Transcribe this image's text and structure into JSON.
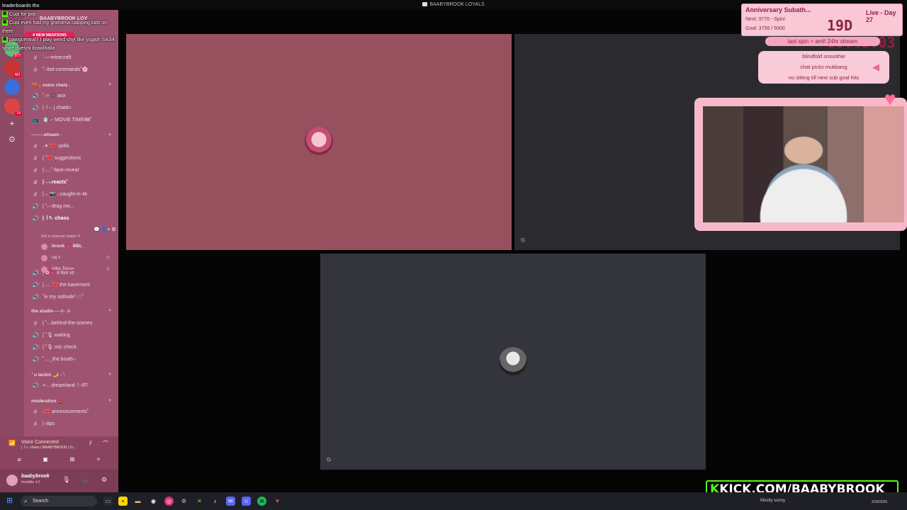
{
  "window": {
    "title": "BAABYBROOK LOYALS"
  },
  "chat_overlay": {
    "lines": [
      "leaderboards tho",
      "Cupi for pvp",
      "Cupi even had my grandma calpping kids on",
      "there",
      "pawgcentral7 I play weird shyt like yugioh SAS4",
      "smite duelyst brawlhalla"
    ]
  },
  "mentions": "4 NEW MENTIONS",
  "sidebar": {
    "server_name": "BAABYBROOK LOY",
    "rail_badges": [
      "973",
      "461",
      "14"
    ],
    "channels": [
      {
        "sym": "#",
        "label": "˙-˖--minecraft"
      },
      {
        "sym": "#",
        "label": "˚˖-bot-commands˚🌸"
      },
      {
        "cat": "˚🍓˖. voice chats ˖"
      },
      {
        "sym": "🔊",
        "label": "˚˖⊹🎧 aux"
      },
      {
        "sym": "🔊",
        "label": "| ꒰-˖ j chattin"
      },
      {
        "sym": "📺",
        "label": "🍵 ˖- MOVIE TIME🎟˚"
      },
      {
        "cat": "˖---──stream ˖"
      },
      {
        "sym": "#",
        "label": "˖✦ 🎀 -polls"
      },
      {
        "sym": "#",
        "label": "| ˚🎀 suggestions"
      },
      {
        "sym": "#",
        "label": "| ˖...˚-face-reveal"
      },
      {
        "sym": "#",
        "label": "| ˖˖-.reacts˚",
        "selected": true
      },
      {
        "sym": "#",
        "label": "| ˖˖ 📷 ₊caught-in-4k"
      },
      {
        "sym": "🔊",
        "label": "| ˚˖˖-drag me..."
      },
      {
        "sym": "🔊",
        "label": "| ꒰ৎ˖ chaos",
        "selected": true
      }
    ],
    "chaos_status": "Set a channel status ✎",
    "members": [
      {
        "name": "brook 💗 BBL",
        "bold": true
      },
      {
        "name": "raj v"
      },
      {
        "name": "Vibe Terror"
      }
    ],
    "channels2": [
      {
        "sym": "🔊",
        "label": "| ✿💗 ɞ live.vc"
      },
      {
        "sym": "🔊",
        "label": "| .... 🎀 the basement"
      },
      {
        "sym": "🔊",
        "label": "˚in my solitude˚˖♡˚"
      },
      {
        "cat": "the studio──⊹˖ ⊹"
      },
      {
        "sym": "#",
        "label": "| ˚˖˖.behind-the-scenes"
      },
      {
        "sym": "🔊",
        "label": "| ˚🎙 waiting"
      },
      {
        "sym": "🔊",
        "label": "| ˚🎙 mic check"
      },
      {
        "sym": "🔊",
        "label": "˚ ..._the booth-˖"
      },
      {
        "cat": "˚ u lackin 🌙 ˖·˚˖"
      },
      {
        "sym": "🔊",
        "label": "⋄ ˖ .dreamland ꒰-ᘔ♡"
      },
      {
        "cat": "moderation 💄"
      },
      {
        "sym": "#",
        "label": "˖🎀 announcements˚"
      },
      {
        "sym": "#",
        "label": "| ‹tips"
      }
    ]
  },
  "voice": {
    "title": "Voice Connected",
    "subtitle": "| ꒰ৎ˖ chaos / BAABYBROOK LO..."
  },
  "user": {
    "name": "baabybrook",
    "status": "Invisible ✦1"
  },
  "subathon": {
    "title": "Anniversary Subath...",
    "next": "Next: 3770 - Spin!",
    "goal": "Goal: 3756 / 5000",
    "day": "Live - Day 27",
    "timer": "19D 00:43:03"
  },
  "spin": "last spin  >  aml! 24hr stream",
  "wheel": [
    "blindfold smoothie",
    "chat picks mukbang",
    "no sitting till next sub goal hits"
  ],
  "kick": {
    "prefix": "K",
    "text": "KICK.COM/BAABYBROOK"
  },
  "taskbar": {
    "search": "Search",
    "weather": "Mostly sunny",
    "date": "2/28/2026"
  },
  "colors": {
    "sidebar": "#9e5470",
    "tile_pink": "#97505e",
    "kick_green": "#53fc18",
    "overlay_pink": "#f9c7d6"
  }
}
